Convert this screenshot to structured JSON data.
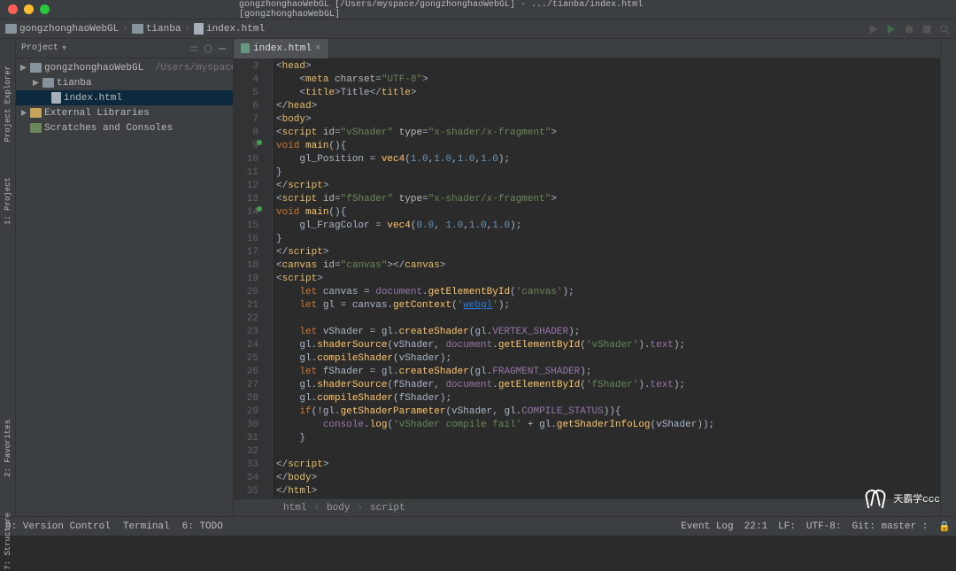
{
  "window": {
    "title": "gongzhonghaoWebGL [/Users/myspace/gongzhonghaoWebGL] - .../tianba/index.html [gongzhonghaoWebGL]"
  },
  "crumbs": {
    "a": "gongzhonghaoWebGL",
    "b": "tianba",
    "c": "index.html"
  },
  "sidebar": {
    "head": "Project",
    "mode": "Project",
    "root": "gongzhonghaoWebGL",
    "root_path": "/Users/myspace/gongzhonghaoWebGL",
    "dir": "tianba",
    "file": "index.html",
    "ext": "External Libraries",
    "scr": "Scratches and Consoles"
  },
  "leftTabs": {
    "a": "Project Explorer",
    "b": "1: Project",
    "c": "2: Favorites",
    "d": "7: Structure"
  },
  "tab": {
    "name": "index.html"
  },
  "lines": [
    {
      "n": 3,
      "html": "&lt;<t>head</t>&gt;"
    },
    {
      "n": 4,
      "html": "    &lt;<t>meta</t> <a>charset</a>=<s>\"UTF-8\"</s>&gt;"
    },
    {
      "n": 5,
      "html": "    &lt;<t>title</t>&gt;Title&lt;/<t>title</t>&gt;"
    },
    {
      "n": 6,
      "html": "&lt;/<t>head</t>&gt;"
    },
    {
      "n": 7,
      "html": "&lt;<t>body</t>&gt;"
    },
    {
      "n": 8,
      "html": "&lt;<t>script</t> <a>id</a>=<s>\"vShader\"</s> <a>type</a>=<s>\"x-shader/x-fragment\"</s>&gt;"
    },
    {
      "n": 9,
      "mark": true,
      "html": "<k>void</k> <f>main</f>(){"
    },
    {
      "n": 10,
      "html": "    gl_Position = <ty>vec4</ty>(<n>1.0</n>,<n>1.0</n>,<n>1.0</n>,<n>1.0</n>);"
    },
    {
      "n": 11,
      "html": "}"
    },
    {
      "n": 12,
      "html": "&lt;/<t>script</t>&gt;"
    },
    {
      "n": 13,
      "html": "&lt;<t>script</t> <a>id</a>=<s>\"fShader\"</s> <a>type</a>=<s>\"x-shader/x-fragment\"</s>&gt;"
    },
    {
      "n": 14,
      "mark": true,
      "html": "<k>void</k> <f>main</f>(){"
    },
    {
      "n": 15,
      "html": "    gl_FragColor = <ty>vec4</ty>(<n>0.0</n>, <n>1.0</n>,<n>1.0</n>,<n>1.0</n>);"
    },
    {
      "n": 16,
      "html": "}"
    },
    {
      "n": 17,
      "html": "&lt;/<t>script</t>&gt;"
    },
    {
      "n": 18,
      "html": "&lt;<t>canvas</t> <a>id</a>=<s>\"canvas\"</s>&gt;&lt;/<t>canvas</t>&gt;"
    },
    {
      "n": 19,
      "html": "&lt;<t>script</t>&gt;"
    },
    {
      "n": 20,
      "html": "    <k>let</k> canvas = <id>document</id>.<f>getElementById</f>(<s>'canvas'</s>);"
    },
    {
      "n": 21,
      "html": "    <k>let</k> gl = canvas.<f>getContext</f>(<s>'</s><l>webgl</l><s>'</s>);"
    },
    {
      "n": 22,
      "html": ""
    },
    {
      "n": 23,
      "html": "    <k>let</k> vShader = gl.<f>createShader</f>(gl.<id>VERTEX_SHADER</id>);"
    },
    {
      "n": 24,
      "html": "    gl.<f>shaderSource</f>(vShader, <id>document</id>.<f>getElementById</f>(<s>'vShader'</s>).<id>text</id>);"
    },
    {
      "n": 25,
      "html": "    gl.<f>compileShader</f>(vShader);"
    },
    {
      "n": 26,
      "html": "    <k>let</k> fShader = gl.<f>createShader</f>(gl.<id>FRAGMENT_SHADER</id>);"
    },
    {
      "n": 27,
      "html": "    gl.<f>shaderSource</f>(fShader, <id>document</id>.<f>getElementById</f>(<s>'fShader'</s>).<id>text</id>);"
    },
    {
      "n": 28,
      "html": "    gl.<f>compileShader</f>(fShader);"
    },
    {
      "n": 29,
      "html": "    <k>if</k>(!gl.<f>getShaderParameter</f>(vShader, gl.<id>COMPILE_STATUS</id>)){"
    },
    {
      "n": 30,
      "html": "        <id>console</id>.<f>log</f>(<s>'vShader compile fail'</s> + gl.<f>getShaderInfoLog</f>(vShader));"
    },
    {
      "n": 31,
      "html": "    }"
    },
    {
      "n": 32,
      "html": ""
    },
    {
      "n": 33,
      "html": "&lt;/<t>script</t>&gt;"
    },
    {
      "n": 34,
      "html": "&lt;/<t>body</t>&gt;"
    },
    {
      "n": 35,
      "html": "&lt;/<t>html</t>&gt;"
    }
  ],
  "bread": {
    "a": "html",
    "b": "body",
    "c": "script"
  },
  "status": {
    "a": "9: Version Control",
    "b": "Terminal",
    "c": "6: TODO",
    "ev": "Event Log",
    "pos": "22:1",
    "lf": "LF:",
    "enc": "UTF-8:",
    "git": "Git: master :",
    "lock": "🔒"
  },
  "watermark": "天霸学ccc"
}
